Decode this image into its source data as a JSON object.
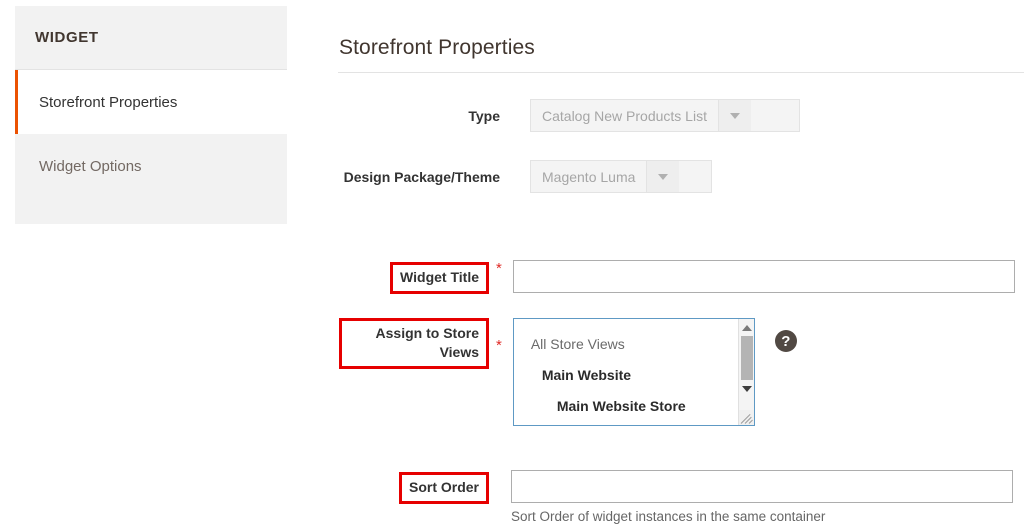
{
  "sidebar": {
    "header_title": "WIDGET",
    "items": [
      {
        "label": "Storefront Properties",
        "active": true
      },
      {
        "label": "Widget Options",
        "active": false
      }
    ]
  },
  "main": {
    "page_title": "Storefront Properties",
    "fields": {
      "type": {
        "label": "Type",
        "value": "Catalog New Products List",
        "disabled": true,
        "arrow_icon": "chevron-down-icon"
      },
      "design_theme": {
        "label": "Design Package/Theme",
        "value": "Magento Luma",
        "disabled": true,
        "arrow_icon": "chevron-down-icon"
      },
      "widget_title": {
        "label": "Widget Title",
        "required_marker": "*",
        "value": "",
        "placeholder": ""
      },
      "assign_store_views": {
        "label": "Assign to Store Views",
        "required_marker": "*",
        "help_icon": "question-mark-icon",
        "options": [
          {
            "label": "All Store Views",
            "level": 0
          },
          {
            "label": "Main Website",
            "level": 1
          },
          {
            "label": "Main Website Store",
            "level": 2
          }
        ]
      },
      "sort_order": {
        "label": "Sort Order",
        "value": "",
        "placeholder": "",
        "note": "Sort Order of widget instances in the same container"
      }
    }
  },
  "colors": {
    "accent_orange": "#eb5202",
    "annotation_red": "#e60000",
    "required_red": "#e02b27",
    "multiselect_border_blue": "#5e99c4"
  }
}
